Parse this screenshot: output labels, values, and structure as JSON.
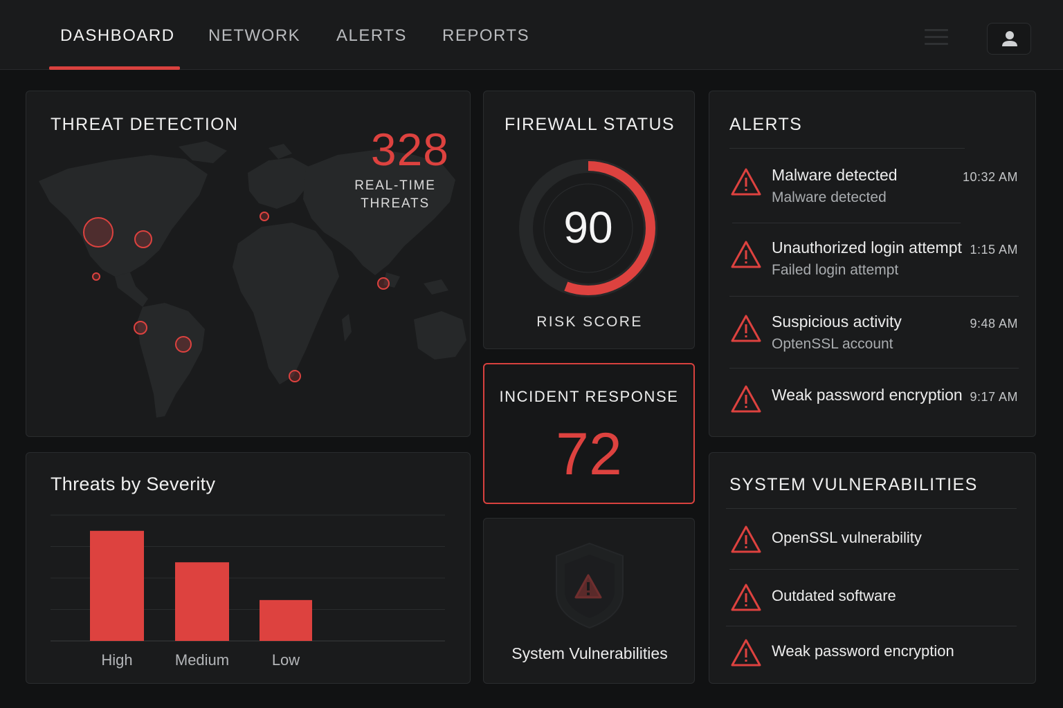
{
  "nav": {
    "tabs": [
      "DASHBOARD",
      "NETWORK",
      "ALERTS",
      "REPORTS"
    ],
    "active_tab": "DASHBOARD",
    "icons": [
      "menu-icon",
      "user-icon"
    ]
  },
  "threat_detection": {
    "title": "THREAT DETECTION",
    "count": "328",
    "count_label_line1": "REAL-TIME",
    "count_label_line2": "THREATS"
  },
  "firewall": {
    "title": "FIREWALL STATUS",
    "score": "90",
    "score_fraction": 0.9,
    "label": "RISK SCORE"
  },
  "incident": {
    "title": "INCIDENT RESPONSE",
    "value": "72"
  },
  "sys_vuln_tile": {
    "label": "System Vulnerabilities"
  },
  "alerts": {
    "title": "ALERTS",
    "items": [
      {
        "title": "Malware detected",
        "subtitle": "Malware detected",
        "time": "10:32 AM"
      },
      {
        "title": "Unauthorized login attempt",
        "subtitle": "Failed login attempt",
        "time": "1:15 AM"
      },
      {
        "title": "Suspicious activity",
        "subtitle": "OptenSSL account",
        "time": "9:48 AM"
      },
      {
        "title": "Weak password encryption",
        "subtitle": "",
        "time": "9:17 AM"
      }
    ]
  },
  "vulnerabilities": {
    "title": "SYSTEM VULNERABILITIES",
    "items": [
      "OpenSSL vulnerability",
      "Outdated software",
      "Weak password encryption"
    ]
  },
  "colors": {
    "accent": "#dd423f",
    "background": "#111213",
    "panel": "#1a1b1c"
  },
  "chart_data": {
    "type": "bar",
    "title": "Threats by Severity",
    "categories": [
      "High",
      "Medium",
      "Low"
    ],
    "values": [
      3.5,
      2.5,
      1.3
    ],
    "ylim": [
      0,
      4
    ],
    "grid": true,
    "xlabel": "",
    "ylabel": ""
  }
}
